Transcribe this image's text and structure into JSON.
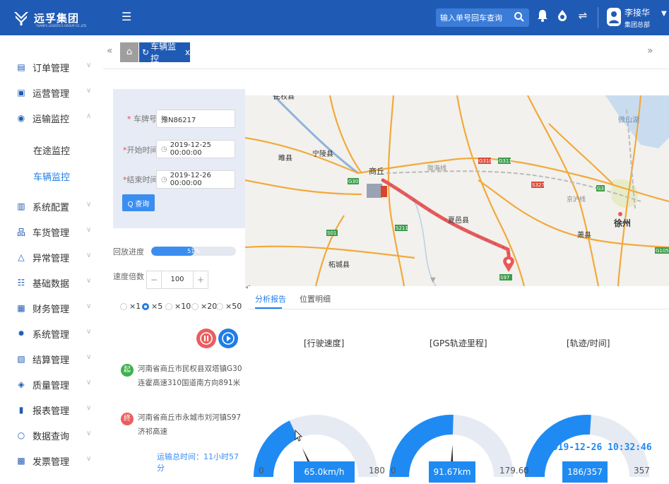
{
  "header": {
    "brand": "远孚集团",
    "brand_sub": "YUANFU LOGISTICS GROUP CO.,LTD",
    "search_placeholder": "输入单号回车查询",
    "user_name": "李接华",
    "user_dept": "集团总部",
    "accent": "#1f5bb5"
  },
  "sidebar": {
    "items": [
      {
        "label": "订单管理",
        "icon": "order-icon"
      },
      {
        "label": "运营管理",
        "icon": "operations-icon"
      },
      {
        "label": "运输监控",
        "icon": "location-icon"
      },
      {
        "label": "系统配置",
        "icon": "config-icon"
      },
      {
        "label": "车货管理",
        "icon": "vehicle-cargo-icon"
      },
      {
        "label": "异常管理",
        "icon": "warning-icon"
      },
      {
        "label": "基础数据",
        "icon": "base-data-icon"
      },
      {
        "label": "财务管理",
        "icon": "finance-icon"
      },
      {
        "label": "系统管理",
        "icon": "gear-icon"
      },
      {
        "label": "结算管理",
        "icon": "settlement-icon"
      },
      {
        "label": "质量管理",
        "icon": "shield-icon"
      },
      {
        "label": "报表管理",
        "icon": "report-icon"
      },
      {
        "label": "数据查询",
        "icon": "search-icon"
      },
      {
        "label": "发票管理",
        "icon": "invoice-icon"
      }
    ],
    "sub_items": [
      "在途监控",
      "车辆监控"
    ]
  },
  "tabs": {
    "active_label": "车辆监控"
  },
  "form": {
    "plate_label": "车牌号",
    "plate_value": "豫N86217",
    "start_label": "开始时间",
    "start_value": "2019-12-25 00:00:00",
    "end_label": "结束时间",
    "end_value": "2019-12-26 00:00:00",
    "query_label": "查询"
  },
  "playback": {
    "progress_label": "回放进度",
    "progress_percent": 51,
    "progress_text": "51%",
    "speed_label": "速度倍数",
    "speed_value": "100",
    "multipliers": [
      "×1",
      "×5",
      "×10",
      "×20",
      "×50"
    ],
    "selected_multiplier": "×5"
  },
  "locations": {
    "start_badge": "起",
    "start_text": "河南省商丘市民权县双塔镇G30连霍高速310国道南方向891米",
    "end_badge": "终",
    "end_text": "河南省商丘市永城市刘河镇S97济祁高速"
  },
  "total_time": "运输总时间：11小时57分",
  "map": {
    "labels": {
      "shangqiu": "商丘",
      "xuzhou": "徐州",
      "ningling": "宁陵县",
      "suixian": "睢县",
      "xiayi": "夏邑县",
      "zhecheng": "柘城县",
      "xiaoxian": "萧县",
      "weishanhu": "微山湖",
      "minquan": "民权县",
      "longhai": "陇海线",
      "jinghu": "京沪线"
    },
    "roads": [
      "G30",
      "G310",
      "G311",
      "S01",
      "S211",
      "S327",
      "G3",
      "S97",
      "G105"
    ],
    "route_color": "#e85a5a"
  },
  "analysis": {
    "tabs": [
      "分析报告",
      "位置明细"
    ],
    "active_tab": "分析报告",
    "gauges": [
      {
        "title": "[行驶速度]",
        "value": 65.0,
        "min": 0,
        "max": 180,
        "display": "65.0km/h",
        "min_label": "0",
        "max_label": "180"
      },
      {
        "title": "[GPS轨迹里程]",
        "value": 91.67,
        "min": 0,
        "max": 179.65,
        "display": "91.67km",
        "min_label": "0",
        "max_label": "179.65"
      },
      {
        "title": "[轨迹/时间]",
        "value": 186,
        "min": 0,
        "max": 357,
        "display": "186/357",
        "min_label": "0",
        "max_label": "357",
        "time": "2019-12-26 10:32:46"
      }
    ]
  }
}
